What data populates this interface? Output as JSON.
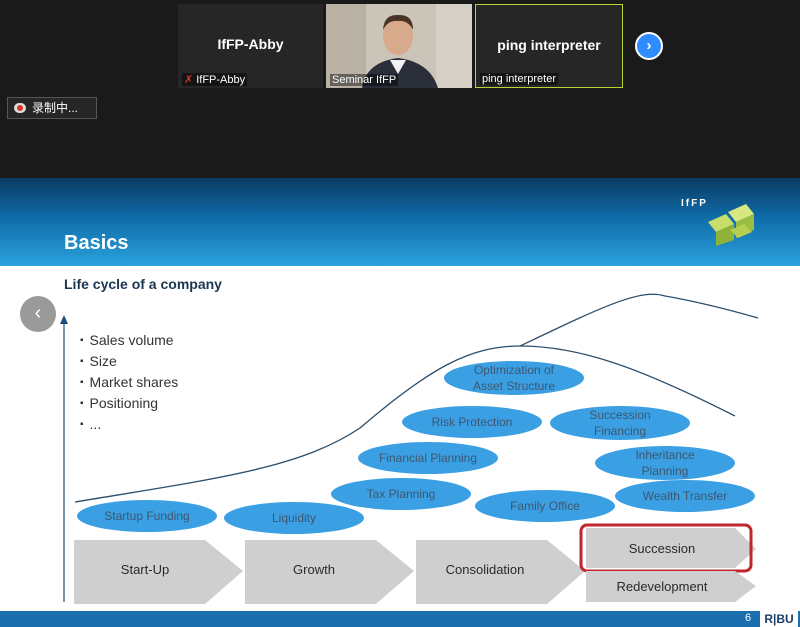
{
  "meeting": {
    "tiles": [
      {
        "name": "IfFP-Abby",
        "label": "IfFP-Abby"
      },
      {
        "label": "Seminar IfFP"
      },
      {
        "name": "ping interpreter",
        "label": "ping interpreter"
      }
    ],
    "recording": "录制中..."
  },
  "slide": {
    "title": "Basics",
    "logo_text": "IfFP",
    "subtitle": "Life cycle of a company",
    "bullets": [
      "Sales volume",
      "Size",
      "Market shares",
      "Positioning",
      "..."
    ],
    "services": [
      {
        "lines": [
          "Startup Funding"
        ]
      },
      {
        "lines": [
          "Liquidity"
        ]
      },
      {
        "lines": [
          "Tax Planning"
        ]
      },
      {
        "lines": [
          "Financial Planning"
        ]
      },
      {
        "lines": [
          "Risk Protection"
        ]
      },
      {
        "lines": [
          "Optimization of",
          "Asset Structure"
        ]
      },
      {
        "lines": [
          "Family Office"
        ]
      },
      {
        "lines": [
          "Succession",
          "Financing"
        ]
      },
      {
        "lines": [
          "Inheritance",
          "Planning"
        ]
      },
      {
        "lines": [
          "Wealth Transfer"
        ]
      }
    ],
    "phases": [
      "Start-Up",
      "Growth",
      "Consolidation",
      "Succession",
      "Redevelopment"
    ],
    "highlighted_phase": "Succession",
    "page_number": "6",
    "brand": "R|BU",
    "colors": {
      "ellipse": "#3aa0e3",
      "highlight": "#c0272d",
      "arrow": "#cfcfcf"
    }
  }
}
